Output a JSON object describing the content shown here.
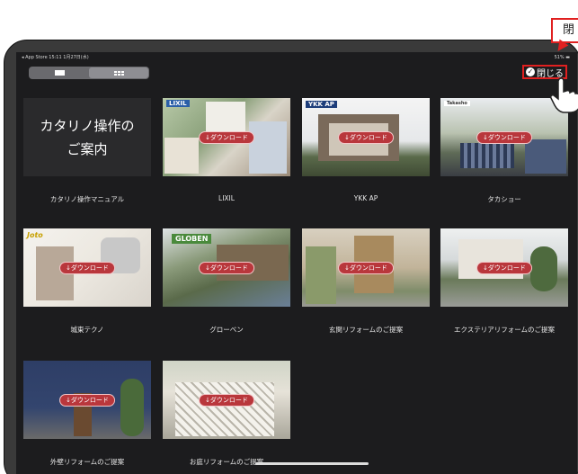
{
  "status_bar": {
    "left": "◂ App Store  15:11  1月27日(水)",
    "right": "51% ▬"
  },
  "toolbar": {
    "close_label": "閉じる"
  },
  "callout": {
    "text": "閉"
  },
  "guide_card": {
    "title": "カタリノ操作の\nご案内",
    "label": "カタリノ操作マニュアル"
  },
  "download_label": "↓ダウンロード",
  "cards": [
    {
      "label": "LIXIL",
      "brand": "LIXIL"
    },
    {
      "label": "YKK AP",
      "brand": "YKK AP"
    },
    {
      "label": "タカショー",
      "brand": "Takasho"
    },
    {
      "label": "城東テクノ",
      "brand": "Joto"
    },
    {
      "label": "グローベン",
      "brand": "GLOBEN"
    },
    {
      "label": "玄関リフォームのご提案",
      "brand": ""
    },
    {
      "label": "エクステリアリフォームのご提案",
      "brand": ""
    },
    {
      "label": "外壁リフォームのご提案",
      "brand": ""
    },
    {
      "label": "お庭リフォームのご提案",
      "brand": ""
    }
  ],
  "colors": {
    "accent": "#e02020",
    "badge": "#b9373c",
    "screen_bg": "#1c1c1e"
  }
}
